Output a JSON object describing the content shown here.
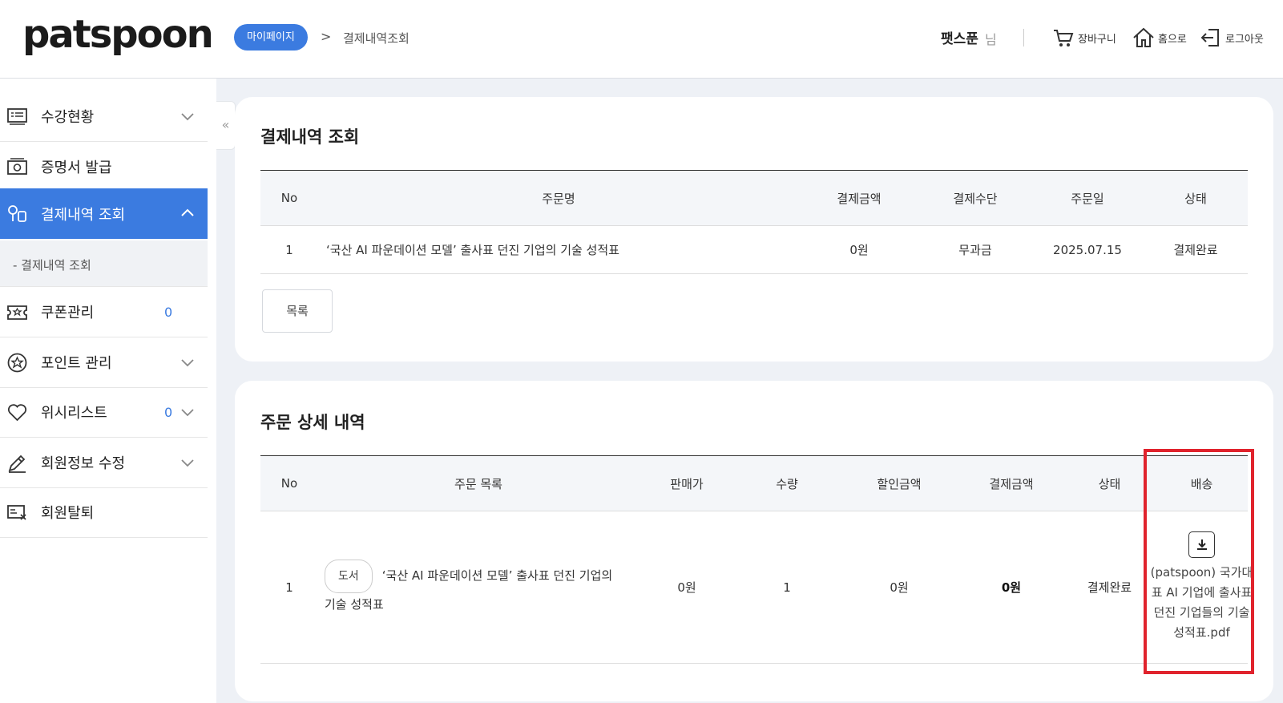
{
  "header": {
    "logo": "patspoon",
    "breadcrumb_pill": "마이페이지",
    "breadcrumb_sep": ">",
    "breadcrumb_current": "결제내역조회",
    "user_name": "팻스푼",
    "user_suffix": "님",
    "cart_label": "장바구니",
    "home_label": "홈으로",
    "logout_label": "로그아웃"
  },
  "sidebar": {
    "items": [
      {
        "label": "수강현황"
      },
      {
        "label": "증명서 발급"
      },
      {
        "label": "결제내역 조회"
      },
      {
        "label": "쿠폰관리",
        "count": "0"
      },
      {
        "label": "포인트 관리"
      },
      {
        "label": "위시리스트",
        "count": "0"
      },
      {
        "label": "회원정보 수정"
      },
      {
        "label": "회원탈퇴"
      }
    ],
    "sub_item": "- 결제내역 조회",
    "collapse_glyph": "«"
  },
  "payment": {
    "title": "결제내역 조회",
    "headers": [
      "No",
      "주문명",
      "결제금액",
      "결제수단",
      "주문일",
      "상태"
    ],
    "rows": [
      {
        "no": "1",
        "name": "‘국산 AI 파운데이션 모델’ 출사표 던진 기업의 기술 성적표",
        "amount": "0원",
        "method": "무과금",
        "date": "2025.07.15",
        "status": "결제완료"
      }
    ],
    "list_button": "목록"
  },
  "detail": {
    "title": "주문 상세 내역",
    "headers": [
      "No",
      "주문 목록",
      "판매가",
      "수량",
      "할인금액",
      "결제금액",
      "상태",
      "배송"
    ],
    "rows": [
      {
        "no": "1",
        "tag": "도서",
        "name": "‘국산 AI 파운데이션 모델’ 출사표 던진 기업의 기술 성적표",
        "price": "0원",
        "qty": "1",
        "discount": "0원",
        "paid": "0원",
        "status": "결제완료",
        "file": "(patspoon) 국가대표 AI 기업에 출사표 던진 기업들의 기술 성적표.pdf"
      }
    ]
  },
  "colors": {
    "accent": "#3b7be0",
    "highlight": "#e0232d",
    "main_bg": "#eef1f6"
  },
  "icons": [
    "cart-icon",
    "home-icon",
    "logout-icon",
    "monitor-list-icon",
    "certificate-icon",
    "payment-icon",
    "coupon-icon",
    "point-icon",
    "heart-icon",
    "pencil-icon",
    "id-card-icon",
    "chevron-down-icon",
    "chevron-up-icon",
    "download-icon"
  ]
}
